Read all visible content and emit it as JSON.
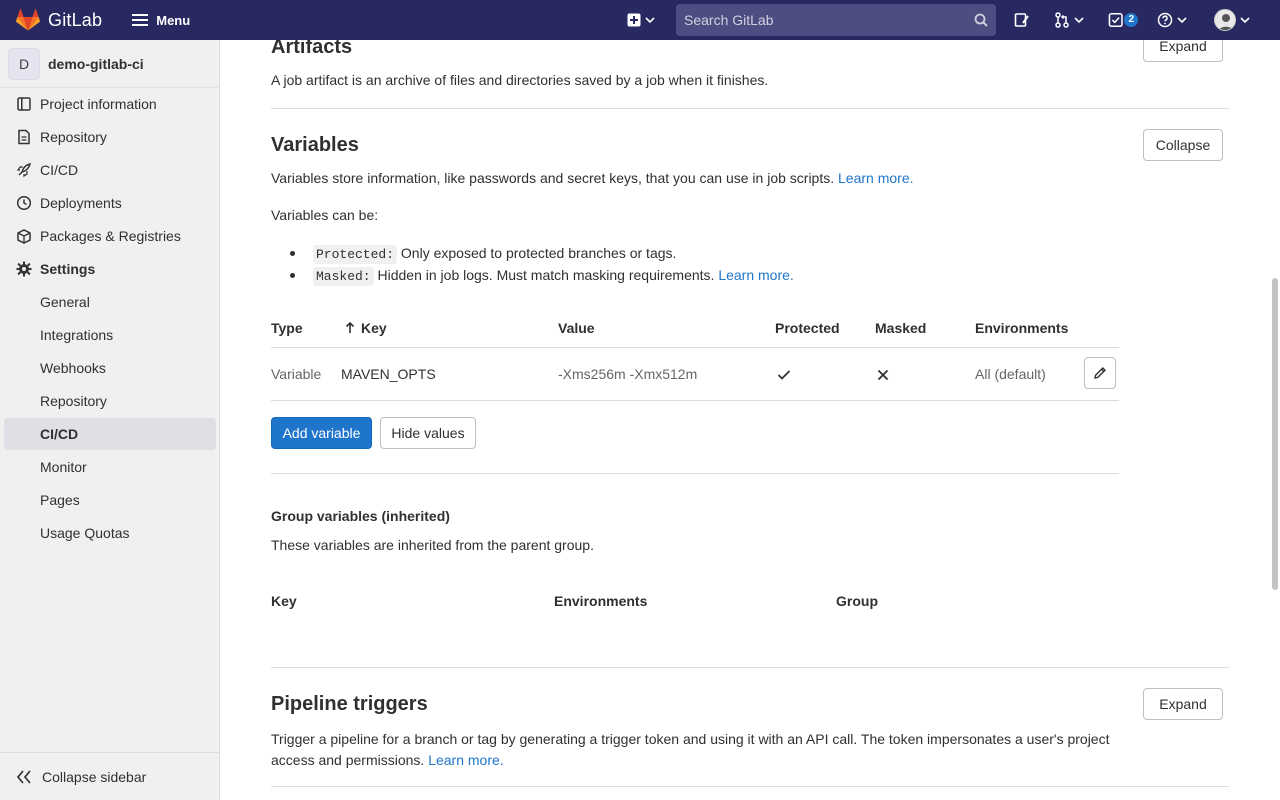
{
  "topbar": {
    "brand": "GitLab",
    "menu_label": "Menu",
    "search_placeholder": "Search GitLab",
    "todos_count": "2"
  },
  "sidebar": {
    "project_initial": "D",
    "project_name": "demo-gitlab-ci",
    "items": [
      {
        "label": "Project information"
      },
      {
        "label": "Repository"
      },
      {
        "label": "CI/CD"
      },
      {
        "label": "Deployments"
      },
      {
        "label": "Packages & Registries"
      },
      {
        "label": "Settings"
      }
    ],
    "settings_sub": [
      {
        "label": "General"
      },
      {
        "label": "Integrations"
      },
      {
        "label": "Webhooks"
      },
      {
        "label": "Repository"
      },
      {
        "label": "CI/CD"
      },
      {
        "label": "Monitor"
      },
      {
        "label": "Pages"
      },
      {
        "label": "Usage Quotas"
      }
    ],
    "collapse_label": "Collapse sidebar"
  },
  "artifacts": {
    "title": "Artifacts",
    "description": "A job artifact is an archive of files and directories saved by a job when it finishes.",
    "button": "Expand"
  },
  "variables": {
    "title": "Variables",
    "button": "Collapse",
    "description": "Variables store information, like passwords and secret keys, that you can use in job scripts.",
    "learn_more": "Learn more.",
    "can_be": "Variables can be:",
    "protected_code": "Protected:",
    "protected_text": "Only exposed to protected branches or tags.",
    "masked_code": "Masked:",
    "masked_text": "Hidden in job logs. Must match masking requirements.",
    "masked_learn_more": "Learn more.",
    "table": {
      "headers": {
        "type": "Type",
        "key": "Key",
        "value": "Value",
        "protected": "Protected",
        "masked": "Masked",
        "environments": "Environments"
      },
      "row": {
        "type": "Variable",
        "key": "MAVEN_OPTS",
        "value": "-Xms256m -Xmx512m",
        "environments": "All (default)"
      }
    },
    "add_button": "Add variable",
    "hide_button": "Hide values"
  },
  "group_variables": {
    "title": "Group variables (inherited)",
    "description": "These variables are inherited from the parent group.",
    "headers": {
      "key": "Key",
      "environments": "Environments",
      "group": "Group"
    }
  },
  "pipeline_triggers": {
    "title": "Pipeline triggers",
    "button": "Expand",
    "description": "Trigger a pipeline for a branch or tag by generating a trigger token and using it with an API call. The token impersonates a user's project access and permissions.",
    "learn_more": "Learn more."
  }
}
